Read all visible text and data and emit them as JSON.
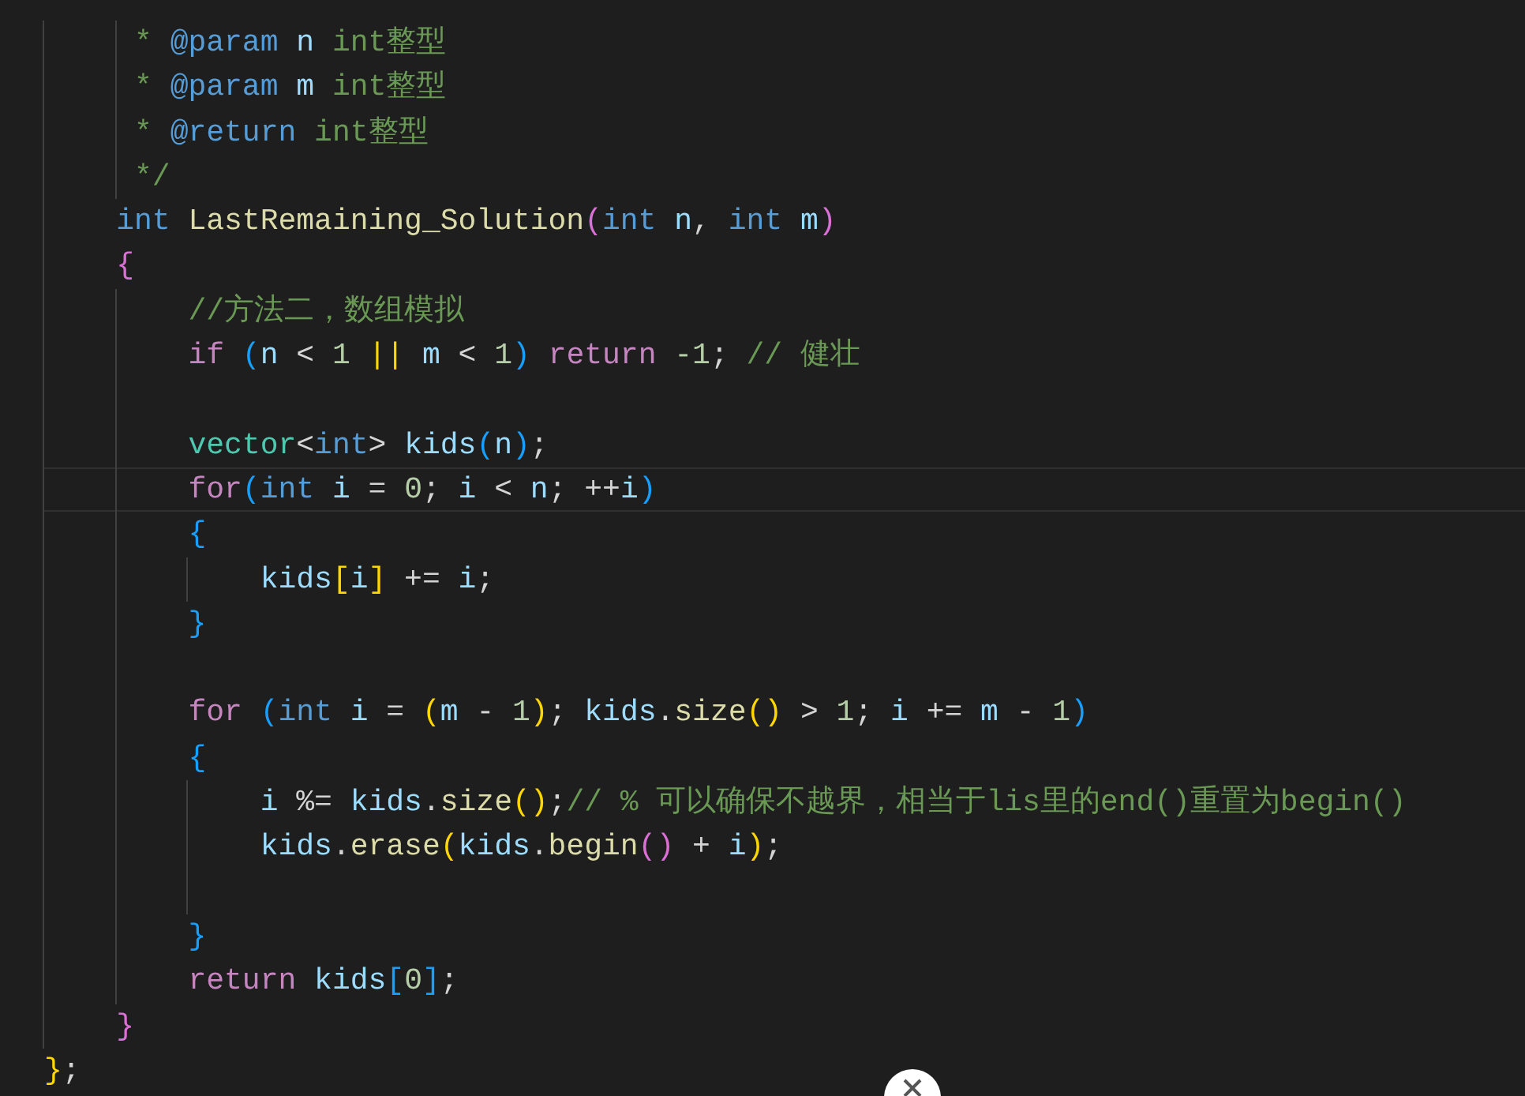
{
  "editor": {
    "lines": [
      {
        "kind": "code",
        "current": false,
        "tokens": [
          {
            "text": "     * ",
            "kind": "comment"
          },
          {
            "text": "@param",
            "kind": "tag"
          },
          {
            "text": " n",
            "kind": "var"
          },
          {
            "text": " int整型",
            "kind": "comment"
          }
        ]
      },
      {
        "kind": "code",
        "current": false,
        "tokens": [
          {
            "text": "     * ",
            "kind": "comment"
          },
          {
            "text": "@param",
            "kind": "tag"
          },
          {
            "text": " m",
            "kind": "var"
          },
          {
            "text": " int整型",
            "kind": "comment"
          }
        ]
      },
      {
        "kind": "code",
        "current": false,
        "tokens": [
          {
            "text": "     * ",
            "kind": "comment"
          },
          {
            "text": "@return",
            "kind": "tag"
          },
          {
            "text": " int整型",
            "kind": "comment"
          }
        ]
      },
      {
        "kind": "code",
        "current": false,
        "tokens": [
          {
            "text": "     */",
            "kind": "comment"
          }
        ]
      },
      {
        "kind": "code",
        "current": false,
        "tokens": [
          {
            "text": "    int",
            "kind": "keyword"
          },
          {
            "text": " LastRemaining_Solution",
            "kind": "function"
          },
          {
            "text": "(",
            "kind": "bracket-pink"
          },
          {
            "text": "int",
            "kind": "keyword"
          },
          {
            "text": " n",
            "kind": "var"
          },
          {
            "text": ", ",
            "kind": "punct"
          },
          {
            "text": "int",
            "kind": "keyword"
          },
          {
            "text": " m",
            "kind": "var"
          },
          {
            "text": ")",
            "kind": "bracket-pink"
          }
        ]
      },
      {
        "kind": "code",
        "current": false,
        "tokens": [
          {
            "text": "    {",
            "kind": "bracket-pink"
          }
        ]
      },
      {
        "kind": "code",
        "current": false,
        "tokens": [
          {
            "text": "        //方法二，数组模拟",
            "kind": "comment"
          }
        ]
      },
      {
        "kind": "code",
        "current": false,
        "tokens": [
          {
            "text": "        if",
            "kind": "control"
          },
          {
            "text": " (",
            "kind": "bracket-blue"
          },
          {
            "text": "n",
            "kind": "var"
          },
          {
            "text": " < ",
            "kind": "punct"
          },
          {
            "text": "1",
            "kind": "number"
          },
          {
            "text": " || ",
            "kind": "bracket-gold"
          },
          {
            "text": "m",
            "kind": "var"
          },
          {
            "text": " < ",
            "kind": "punct"
          },
          {
            "text": "1",
            "kind": "number"
          },
          {
            "text": ")",
            "kind": "bracket-blue"
          },
          {
            "text": " return",
            "kind": "control"
          },
          {
            "text": " -1",
            "kind": "number"
          },
          {
            "text": "; ",
            "kind": "punct"
          },
          {
            "text": "// 健壮",
            "kind": "comment"
          }
        ]
      },
      {
        "kind": "blank",
        "current": false
      },
      {
        "kind": "code",
        "current": false,
        "tokens": [
          {
            "text": "        vector",
            "kind": "type"
          },
          {
            "text": "<",
            "kind": "punct"
          },
          {
            "text": "int",
            "kind": "keyword"
          },
          {
            "text": ">",
            "kind": "punct"
          },
          {
            "text": " kids",
            "kind": "var"
          },
          {
            "text": "(",
            "kind": "bracket-blue"
          },
          {
            "text": "n",
            "kind": "var"
          },
          {
            "text": ")",
            "kind": "bracket-blue"
          },
          {
            "text": ";",
            "kind": "punct"
          }
        ]
      },
      {
        "kind": "code",
        "current": true,
        "tokens": [
          {
            "text": "        for",
            "kind": "control"
          },
          {
            "text": "(",
            "kind": "bracket-blue"
          },
          {
            "text": "int",
            "kind": "keyword"
          },
          {
            "text": " i",
            "kind": "var"
          },
          {
            "text": " = ",
            "kind": "punct"
          },
          {
            "text": "0",
            "kind": "number"
          },
          {
            "text": "; ",
            "kind": "punct"
          },
          {
            "text": "i",
            "kind": "var"
          },
          {
            "text": " < ",
            "kind": "punct"
          },
          {
            "text": "n",
            "kind": "var"
          },
          {
            "text": "; ++",
            "kind": "punct"
          },
          {
            "text": "i",
            "kind": "var"
          },
          {
            "text": ")",
            "kind": "bracket-blue"
          }
        ]
      },
      {
        "kind": "code",
        "current": false,
        "tokens": [
          {
            "text": "        {",
            "kind": "bracket-blue"
          }
        ]
      },
      {
        "kind": "code",
        "current": false,
        "tokens": [
          {
            "text": "            kids",
            "kind": "var"
          },
          {
            "text": "[",
            "kind": "bracket-gold"
          },
          {
            "text": "i",
            "kind": "var"
          },
          {
            "text": "]",
            "kind": "bracket-gold"
          },
          {
            "text": " += ",
            "kind": "punct"
          },
          {
            "text": "i",
            "kind": "var"
          },
          {
            "text": ";",
            "kind": "punct"
          }
        ]
      },
      {
        "kind": "code",
        "current": false,
        "tokens": [
          {
            "text": "        }",
            "kind": "bracket-blue"
          }
        ]
      },
      {
        "kind": "blank",
        "current": false
      },
      {
        "kind": "code",
        "current": false,
        "tokens": [
          {
            "text": "        for",
            "kind": "control"
          },
          {
            "text": " (",
            "kind": "bracket-blue"
          },
          {
            "text": "int",
            "kind": "keyword"
          },
          {
            "text": " i",
            "kind": "var"
          },
          {
            "text": " = ",
            "kind": "punct"
          },
          {
            "text": "(",
            "kind": "bracket-gold"
          },
          {
            "text": "m",
            "kind": "var"
          },
          {
            "text": " - ",
            "kind": "punct"
          },
          {
            "text": "1",
            "kind": "number"
          },
          {
            "text": ")",
            "kind": "bracket-gold"
          },
          {
            "text": "; ",
            "kind": "punct"
          },
          {
            "text": "kids",
            "kind": "var"
          },
          {
            "text": ".",
            "kind": "punct"
          },
          {
            "text": "size",
            "kind": "function"
          },
          {
            "text": "()",
            "kind": "bracket-gold"
          },
          {
            "text": " > ",
            "kind": "punct"
          },
          {
            "text": "1",
            "kind": "number"
          },
          {
            "text": "; ",
            "kind": "punct"
          },
          {
            "text": "i",
            "kind": "var"
          },
          {
            "text": " += ",
            "kind": "punct"
          },
          {
            "text": "m",
            "kind": "var"
          },
          {
            "text": " - ",
            "kind": "punct"
          },
          {
            "text": "1",
            "kind": "number"
          },
          {
            "text": ")",
            "kind": "bracket-blue"
          }
        ]
      },
      {
        "kind": "code",
        "current": false,
        "tokens": [
          {
            "text": "        {",
            "kind": "bracket-blue"
          }
        ]
      },
      {
        "kind": "code",
        "current": false,
        "tokens": [
          {
            "text": "            i",
            "kind": "var"
          },
          {
            "text": " %= ",
            "kind": "punct"
          },
          {
            "text": "kids",
            "kind": "var"
          },
          {
            "text": ".",
            "kind": "punct"
          },
          {
            "text": "size",
            "kind": "function"
          },
          {
            "text": "()",
            "kind": "bracket-gold"
          },
          {
            "text": ";",
            "kind": "punct"
          },
          {
            "text": "// % 可以确保不越界，相当于lis里的end()重置为begin()",
            "kind": "comment"
          }
        ]
      },
      {
        "kind": "code",
        "current": false,
        "tokens": [
          {
            "text": "            kids",
            "kind": "var"
          },
          {
            "text": ".",
            "kind": "punct"
          },
          {
            "text": "erase",
            "kind": "function"
          },
          {
            "text": "(",
            "kind": "bracket-gold"
          },
          {
            "text": "kids",
            "kind": "var"
          },
          {
            "text": ".",
            "kind": "punct"
          },
          {
            "text": "begin",
            "kind": "function"
          },
          {
            "text": "()",
            "kind": "bracket-pink"
          },
          {
            "text": " + ",
            "kind": "punct"
          },
          {
            "text": "i",
            "kind": "var"
          },
          {
            "text": ")",
            "kind": "bracket-gold"
          },
          {
            "text": ";",
            "kind": "punct"
          }
        ]
      },
      {
        "kind": "blank",
        "current": false
      },
      {
        "kind": "code",
        "current": false,
        "tokens": [
          {
            "text": "        }",
            "kind": "bracket-blue"
          }
        ]
      },
      {
        "kind": "code",
        "current": false,
        "tokens": [
          {
            "text": "        return",
            "kind": "control"
          },
          {
            "text": " kids",
            "kind": "var"
          },
          {
            "text": "[",
            "kind": "bracket-blue"
          },
          {
            "text": "0",
            "kind": "number"
          },
          {
            "text": "]",
            "kind": "bracket-blue"
          },
          {
            "text": ";",
            "kind": "punct"
          }
        ]
      },
      {
        "kind": "code",
        "current": false,
        "tokens": [
          {
            "text": "    }",
            "kind": "bracket-pink"
          }
        ]
      },
      {
        "kind": "code",
        "current": false,
        "tokens": [
          {
            "text": "}",
            "kind": "bracket-gold"
          },
          {
            "text": ";",
            "kind": "punct"
          }
        ]
      }
    ]
  }
}
